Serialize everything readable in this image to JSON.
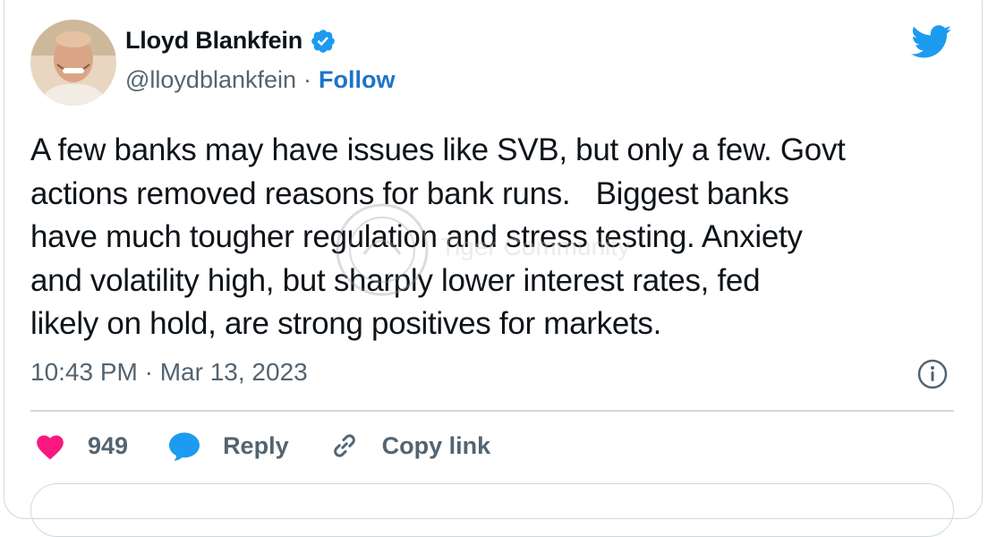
{
  "author": {
    "name": "Lloyd Blankfein",
    "handle": "@lloydblankfein",
    "separator": "·",
    "follow_label": "Follow"
  },
  "tweet": {
    "text": "A few banks may have issues like SVB, but only a few. Govt\nactions removed reasons for bank runs.   Biggest banks\nhave much tougher regulation and stress testing. Anxiety\nand volatility high, but sharply lower interest rates, fed\nlikely on hold, are strong positives for markets.",
    "timestamp": "10:43 PM · Mar 13, 2023"
  },
  "actions": {
    "likes": "949",
    "reply_label": "Reply",
    "copy_link_label": "Copy link"
  },
  "watermark": {
    "text": "Tiger Community"
  },
  "colors": {
    "accent": "#1d9bf0",
    "like": "#f91880",
    "muted": "#536471",
    "border": "#cfd9de"
  },
  "icons": [
    "verified-badge-icon",
    "twitter-bird-icon",
    "info-icon",
    "heart-icon",
    "reply-icon",
    "link-icon"
  ]
}
